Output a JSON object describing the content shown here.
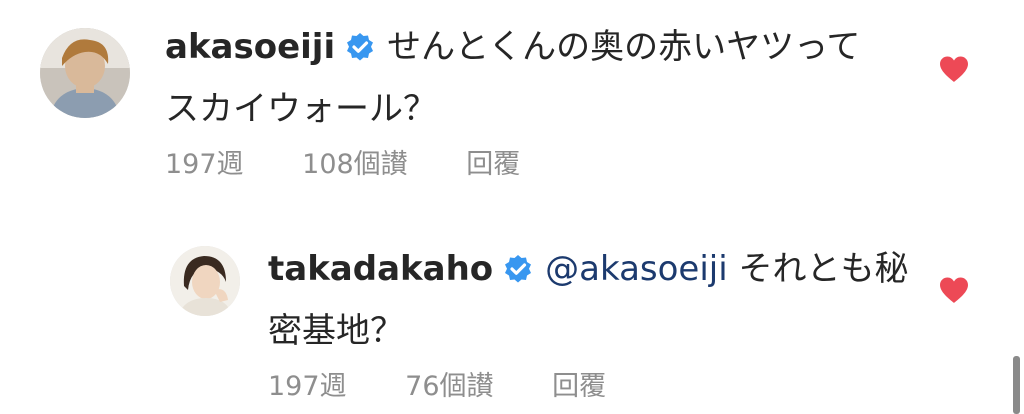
{
  "comments": [
    {
      "username": "akasoeiji",
      "text_line1": "せんとくんの奥の赤いヤツって",
      "text_line2": "スカイウォール？",
      "time": "197週",
      "likes": "108個讃",
      "reply_label": "回覆",
      "avatar_icon": "person-avatar-icon",
      "verified_icon": "verified-badge-icon",
      "like_icon": "heart-icon",
      "liked": true
    },
    {
      "username": "takadakaho",
      "mention": "@akasoeiji",
      "text_line1": "それとも秘",
      "text_line2": "密基地？",
      "time": "197週",
      "likes": "76個讃",
      "reply_label": "回覆",
      "avatar_icon": "person-avatar-icon",
      "verified_icon": "verified-badge-icon",
      "like_icon": "heart-icon",
      "liked": true
    }
  ],
  "colors": {
    "heart": "#ed4956",
    "verified": "#3897f0",
    "meta_text": "#8e8e8e",
    "mention": "#1c3a6e"
  }
}
